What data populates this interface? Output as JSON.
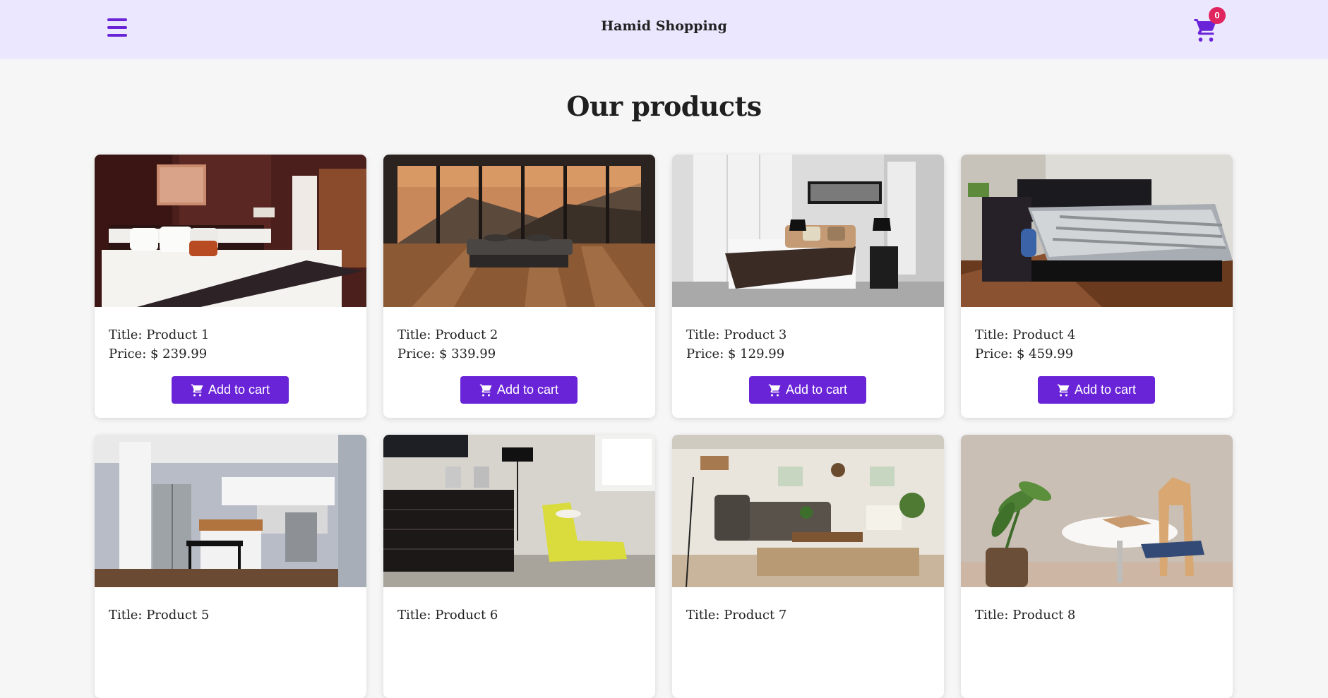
{
  "header": {
    "brand": "Hamid Shopping",
    "menu_icon": "hamburger-menu-icon",
    "cart_icon": "shopping-cart-icon",
    "cart_count": "0",
    "accent_color": "#6a24d8",
    "badge_color": "#e0245e",
    "background": "#ebe7fe"
  },
  "main": {
    "heading": "Our products",
    "button_label": "Add to cart",
    "products": [
      {
        "title": "Title: Product 1",
        "price": "Price: $ 239.99",
        "image": "bedroom with patterned bedding"
      },
      {
        "title": "Title: Product 2",
        "price": "Price: $ 339.99",
        "image": "bed facing mountain window"
      },
      {
        "title": "Title: Product 3",
        "price": "Price: $ 129.99",
        "image": "white bedroom with lamps"
      },
      {
        "title": "Title: Product 4",
        "price": "Price: $ 459.99",
        "image": "sunlit bedroom striped duvet"
      },
      {
        "title": "Title: Product 5",
        "price": "",
        "image": "kitchen with stainless fridge"
      },
      {
        "title": "Title: Product 6",
        "price": "",
        "image": "yellow chaise lounge"
      },
      {
        "title": "Title: Product 7",
        "price": "",
        "image": "living room with sofa"
      },
      {
        "title": "Title: Product 8",
        "price": "",
        "image": "round table with chair and plant"
      }
    ]
  }
}
